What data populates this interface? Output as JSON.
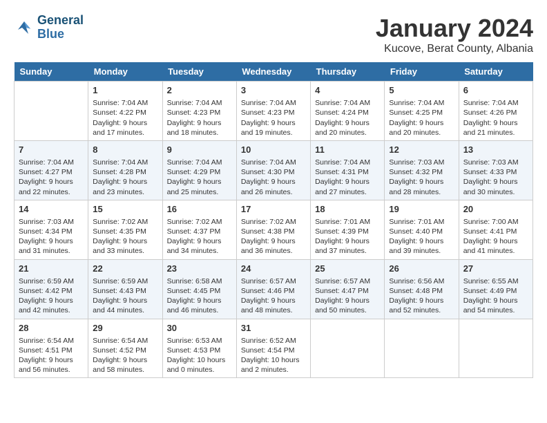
{
  "header": {
    "logo_line1": "General",
    "logo_line2": "Blue",
    "month": "January 2024",
    "location": "Kucove, Berat County, Albania"
  },
  "days_of_week": [
    "Sunday",
    "Monday",
    "Tuesday",
    "Wednesday",
    "Thursday",
    "Friday",
    "Saturday"
  ],
  "weeks": [
    [
      {
        "day": "",
        "data": ""
      },
      {
        "day": "1",
        "data": "Sunrise: 7:04 AM\nSunset: 4:22 PM\nDaylight: 9 hours\nand 17 minutes."
      },
      {
        "day": "2",
        "data": "Sunrise: 7:04 AM\nSunset: 4:23 PM\nDaylight: 9 hours\nand 18 minutes."
      },
      {
        "day": "3",
        "data": "Sunrise: 7:04 AM\nSunset: 4:23 PM\nDaylight: 9 hours\nand 19 minutes."
      },
      {
        "day": "4",
        "data": "Sunrise: 7:04 AM\nSunset: 4:24 PM\nDaylight: 9 hours\nand 20 minutes."
      },
      {
        "day": "5",
        "data": "Sunrise: 7:04 AM\nSunset: 4:25 PM\nDaylight: 9 hours\nand 20 minutes."
      },
      {
        "day": "6",
        "data": "Sunrise: 7:04 AM\nSunset: 4:26 PM\nDaylight: 9 hours\nand 21 minutes."
      }
    ],
    [
      {
        "day": "7",
        "data": "Sunrise: 7:04 AM\nSunset: 4:27 PM\nDaylight: 9 hours\nand 22 minutes."
      },
      {
        "day": "8",
        "data": "Sunrise: 7:04 AM\nSunset: 4:28 PM\nDaylight: 9 hours\nand 23 minutes."
      },
      {
        "day": "9",
        "data": "Sunrise: 7:04 AM\nSunset: 4:29 PM\nDaylight: 9 hours\nand 25 minutes."
      },
      {
        "day": "10",
        "data": "Sunrise: 7:04 AM\nSunset: 4:30 PM\nDaylight: 9 hours\nand 26 minutes."
      },
      {
        "day": "11",
        "data": "Sunrise: 7:04 AM\nSunset: 4:31 PM\nDaylight: 9 hours\nand 27 minutes."
      },
      {
        "day": "12",
        "data": "Sunrise: 7:03 AM\nSunset: 4:32 PM\nDaylight: 9 hours\nand 28 minutes."
      },
      {
        "day": "13",
        "data": "Sunrise: 7:03 AM\nSunset: 4:33 PM\nDaylight: 9 hours\nand 30 minutes."
      }
    ],
    [
      {
        "day": "14",
        "data": "Sunrise: 7:03 AM\nSunset: 4:34 PM\nDaylight: 9 hours\nand 31 minutes."
      },
      {
        "day": "15",
        "data": "Sunrise: 7:02 AM\nSunset: 4:35 PM\nDaylight: 9 hours\nand 33 minutes."
      },
      {
        "day": "16",
        "data": "Sunrise: 7:02 AM\nSunset: 4:37 PM\nDaylight: 9 hours\nand 34 minutes."
      },
      {
        "day": "17",
        "data": "Sunrise: 7:02 AM\nSunset: 4:38 PM\nDaylight: 9 hours\nand 36 minutes."
      },
      {
        "day": "18",
        "data": "Sunrise: 7:01 AM\nSunset: 4:39 PM\nDaylight: 9 hours\nand 37 minutes."
      },
      {
        "day": "19",
        "data": "Sunrise: 7:01 AM\nSunset: 4:40 PM\nDaylight: 9 hours\nand 39 minutes."
      },
      {
        "day": "20",
        "data": "Sunrise: 7:00 AM\nSunset: 4:41 PM\nDaylight: 9 hours\nand 41 minutes."
      }
    ],
    [
      {
        "day": "21",
        "data": "Sunrise: 6:59 AM\nSunset: 4:42 PM\nDaylight: 9 hours\nand 42 minutes."
      },
      {
        "day": "22",
        "data": "Sunrise: 6:59 AM\nSunset: 4:43 PM\nDaylight: 9 hours\nand 44 minutes."
      },
      {
        "day": "23",
        "data": "Sunrise: 6:58 AM\nSunset: 4:45 PM\nDaylight: 9 hours\nand 46 minutes."
      },
      {
        "day": "24",
        "data": "Sunrise: 6:57 AM\nSunset: 4:46 PM\nDaylight: 9 hours\nand 48 minutes."
      },
      {
        "day": "25",
        "data": "Sunrise: 6:57 AM\nSunset: 4:47 PM\nDaylight: 9 hours\nand 50 minutes."
      },
      {
        "day": "26",
        "data": "Sunrise: 6:56 AM\nSunset: 4:48 PM\nDaylight: 9 hours\nand 52 minutes."
      },
      {
        "day": "27",
        "data": "Sunrise: 6:55 AM\nSunset: 4:49 PM\nDaylight: 9 hours\nand 54 minutes."
      }
    ],
    [
      {
        "day": "28",
        "data": "Sunrise: 6:54 AM\nSunset: 4:51 PM\nDaylight: 9 hours\nand 56 minutes."
      },
      {
        "day": "29",
        "data": "Sunrise: 6:54 AM\nSunset: 4:52 PM\nDaylight: 9 hours\nand 58 minutes."
      },
      {
        "day": "30",
        "data": "Sunrise: 6:53 AM\nSunset: 4:53 PM\nDaylight: 10 hours\nand 0 minutes."
      },
      {
        "day": "31",
        "data": "Sunrise: 6:52 AM\nSunset: 4:54 PM\nDaylight: 10 hours\nand 2 minutes."
      },
      {
        "day": "",
        "data": ""
      },
      {
        "day": "",
        "data": ""
      },
      {
        "day": "",
        "data": ""
      }
    ]
  ]
}
